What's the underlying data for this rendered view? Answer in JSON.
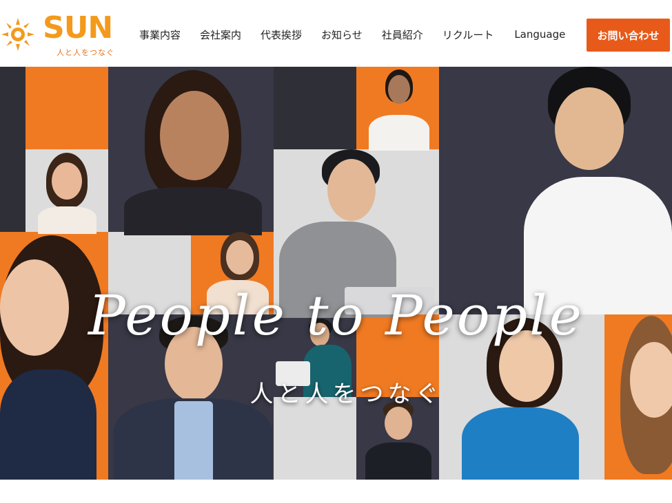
{
  "brand": {
    "logo_text": "SUN",
    "tagline": "人と人をつなぐ",
    "colors": {
      "orange": "#f39a1c",
      "accent": "#e85a19"
    }
  },
  "nav": {
    "items": [
      {
        "label": "事業内容"
      },
      {
        "label": "会社案内"
      },
      {
        "label": "代表挨拶"
      },
      {
        "label": "お知らせ"
      },
      {
        "label": "社員紹介"
      },
      {
        "label": "リクルート"
      },
      {
        "label": "Language"
      }
    ],
    "contact_label": "お問い合わせ"
  },
  "hero": {
    "headline": "People to People",
    "subline": "人と人をつなぐ"
  }
}
